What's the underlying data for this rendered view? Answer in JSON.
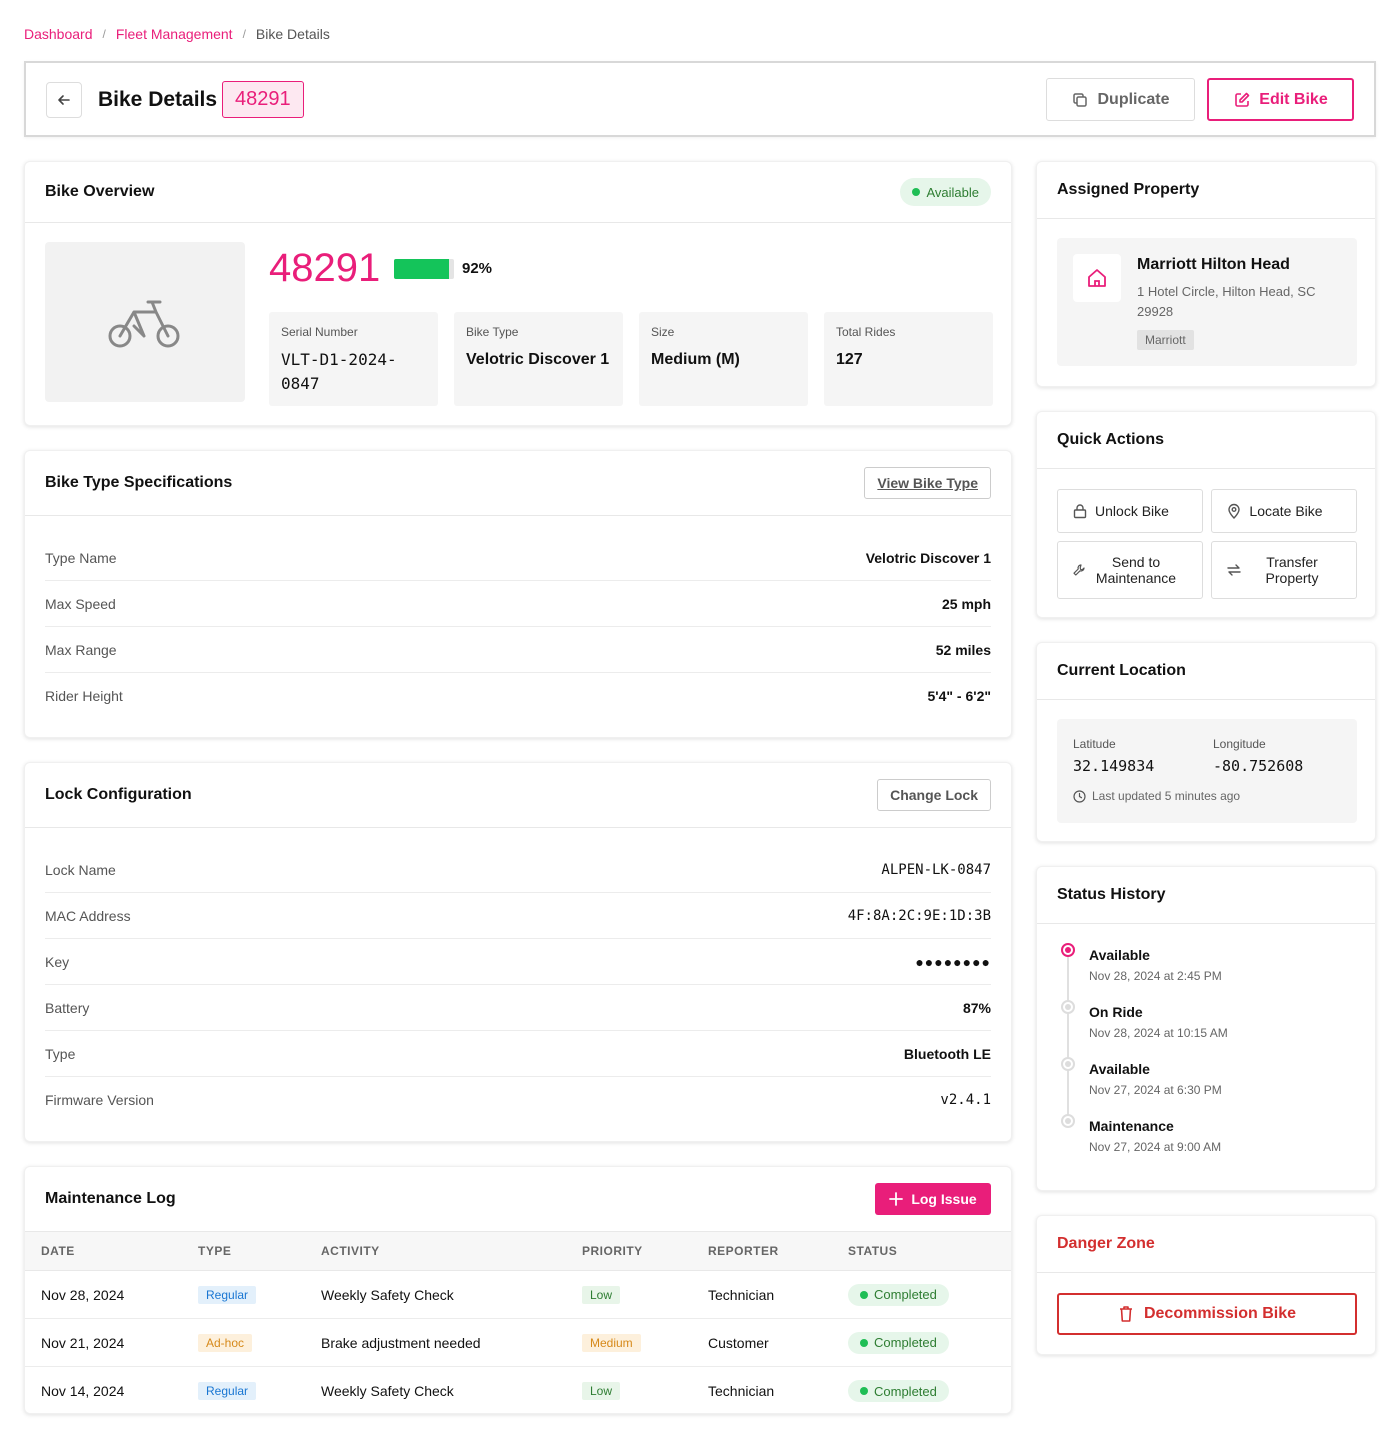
{
  "breadcrumb": {
    "items": [
      "Dashboard",
      "Fleet Management"
    ],
    "current": "Bike Details",
    "separator": "/"
  },
  "header": {
    "title": "Bike Details",
    "bike_id": "48291",
    "duplicate_label": "Duplicate",
    "edit_label": "Edit Bike"
  },
  "colors": {
    "accent": "#e91e7a",
    "success": "#1fbe55",
    "danger": "#d32f2f"
  },
  "overview": {
    "title": "Bike Overview",
    "status": "Available",
    "bike_number": "48291",
    "battery_percent": 92,
    "battery_label": "92%",
    "stats": [
      {
        "label": "Serial Number",
        "value": "VLT-D1-2024-0847"
      },
      {
        "label": "Bike Type",
        "value": "Velotric Discover 1"
      },
      {
        "label": "Size",
        "value": "Medium (M)"
      },
      {
        "label": "Total Rides",
        "value": "127"
      }
    ]
  },
  "specs": {
    "title": "Bike Type Specifications",
    "view_label": "View Bike Type",
    "rows": [
      {
        "label": "Type Name",
        "value": "Velotric Discover 1"
      },
      {
        "label": "Max Speed",
        "value": "25 mph"
      },
      {
        "label": "Max Range",
        "value": "52 miles"
      },
      {
        "label": "Rider Height",
        "value": "5'4\" - 6'2\""
      }
    ]
  },
  "lock": {
    "title": "Lock Configuration",
    "change_label": "Change Lock",
    "rows": [
      {
        "label": "Lock Name",
        "value": "ALPEN-LK-0847"
      },
      {
        "label": "MAC Address",
        "value": "4F:8A:2C:9E:1D:3B"
      },
      {
        "label": "Key",
        "value": "●●●●●●●●"
      },
      {
        "label": "Battery",
        "value": "87%"
      },
      {
        "label": "Type",
        "value": "Bluetooth LE"
      },
      {
        "label": "Firmware Version",
        "value": "v2.4.1"
      }
    ]
  },
  "maintenance": {
    "title": "Maintenance Log",
    "log_label": "Log Issue",
    "columns": [
      "DATE",
      "TYPE",
      "ACTIVITY",
      "PRIORITY",
      "REPORTER",
      "STATUS"
    ],
    "rows": [
      {
        "date": "Nov 28, 2024",
        "type": "Regular",
        "activity": "Weekly Safety Check",
        "priority": "Low",
        "reporter": "Technician",
        "status": "Completed"
      },
      {
        "date": "Nov 21, 2024",
        "type": "Ad-hoc",
        "activity": "Brake adjustment needed",
        "priority": "Medium",
        "reporter": "Customer",
        "status": "Completed"
      },
      {
        "date": "Nov 14, 2024",
        "type": "Regular",
        "activity": "Weekly Safety Check",
        "priority": "Low",
        "reporter": "Technician",
        "status": "Completed"
      }
    ]
  },
  "property": {
    "title": "Assigned Property",
    "name": "Marriott Hilton Head",
    "address": "1 Hotel Circle, Hilton Head, SC 29928",
    "tag": "Marriott"
  },
  "quick_actions": {
    "title": "Quick Actions",
    "items": [
      {
        "label": "Unlock Bike",
        "icon": "lock-icon"
      },
      {
        "label": "Locate Bike",
        "icon": "map-pin-icon"
      },
      {
        "label": "Send to Maintenance",
        "icon": "wrench-icon"
      },
      {
        "label": "Transfer Property",
        "icon": "transfer-icon"
      }
    ]
  },
  "location": {
    "title": "Current Location",
    "lat_label": "Latitude",
    "lat": "32.149834",
    "lon_label": "Longitude",
    "lon": "-80.752608",
    "updated": "Last updated 5 minutes ago"
  },
  "history": {
    "title": "Status History",
    "items": [
      {
        "status": "Available",
        "time": "Nov 28, 2024 at 2:45 PM",
        "active": true
      },
      {
        "status": "On Ride",
        "time": "Nov 28, 2024 at 10:15 AM",
        "active": false
      },
      {
        "status": "Available",
        "time": "Nov 27, 2024 at 6:30 PM",
        "active": false
      },
      {
        "status": "Maintenance",
        "time": "Nov 27, 2024 at 9:00 AM",
        "active": false
      }
    ]
  },
  "danger": {
    "title": "Danger Zone",
    "decommission_label": "Decommission Bike"
  }
}
